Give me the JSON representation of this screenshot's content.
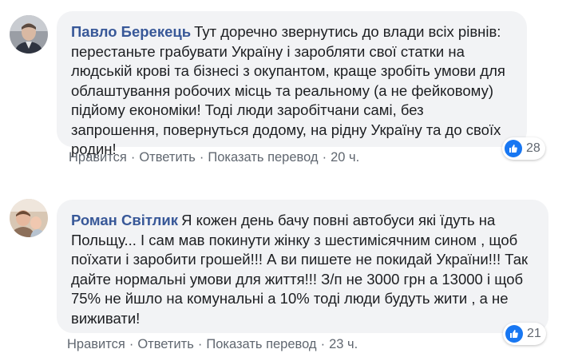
{
  "comments": [
    {
      "author": "Павло Берекець",
      "text": "Тут доречно звернутись до влади всіх рівнів: перестаньте грабувати Україну і заробляти свої статки на людській крові та бізнесі з окупантом, краще зробіть умови для облаштування робочих місць та реальному (а не фейковому) підйому економіки! Тоді люди заробітчани самі, без запрошення, повернуться додому, на рідну Україну та до своїх родин!",
      "like_label": "Нравится",
      "reply_label": "Ответить",
      "translate_label": "Показать перевод",
      "time": "20 ч.",
      "reaction_count": "28",
      "reaction_icon": "like-icon",
      "accent": "#1877f2"
    },
    {
      "author": "Роман Світлик",
      "text": "Я кожен день бачу повні автобуси які їдуть на Польщу... І сам мав покинути жінку з шестимісячним сином , щоб поїхати і заробити грошей!!! А ви пишете не покидай України!!! Так дайте нормальні умови для життя!!! З/п не 3000 грн а 13000 і щоб 75% не йшло на комунальні а 10% тоді люди будуть жити , а не виживати!",
      "like_label": "Нравится",
      "reply_label": "Ответить",
      "translate_label": "Показать перевод",
      "time": "23 ч.",
      "reaction_count": "21",
      "reaction_icon": "like-icon",
      "accent": "#1877f2"
    }
  ],
  "separator": "·"
}
